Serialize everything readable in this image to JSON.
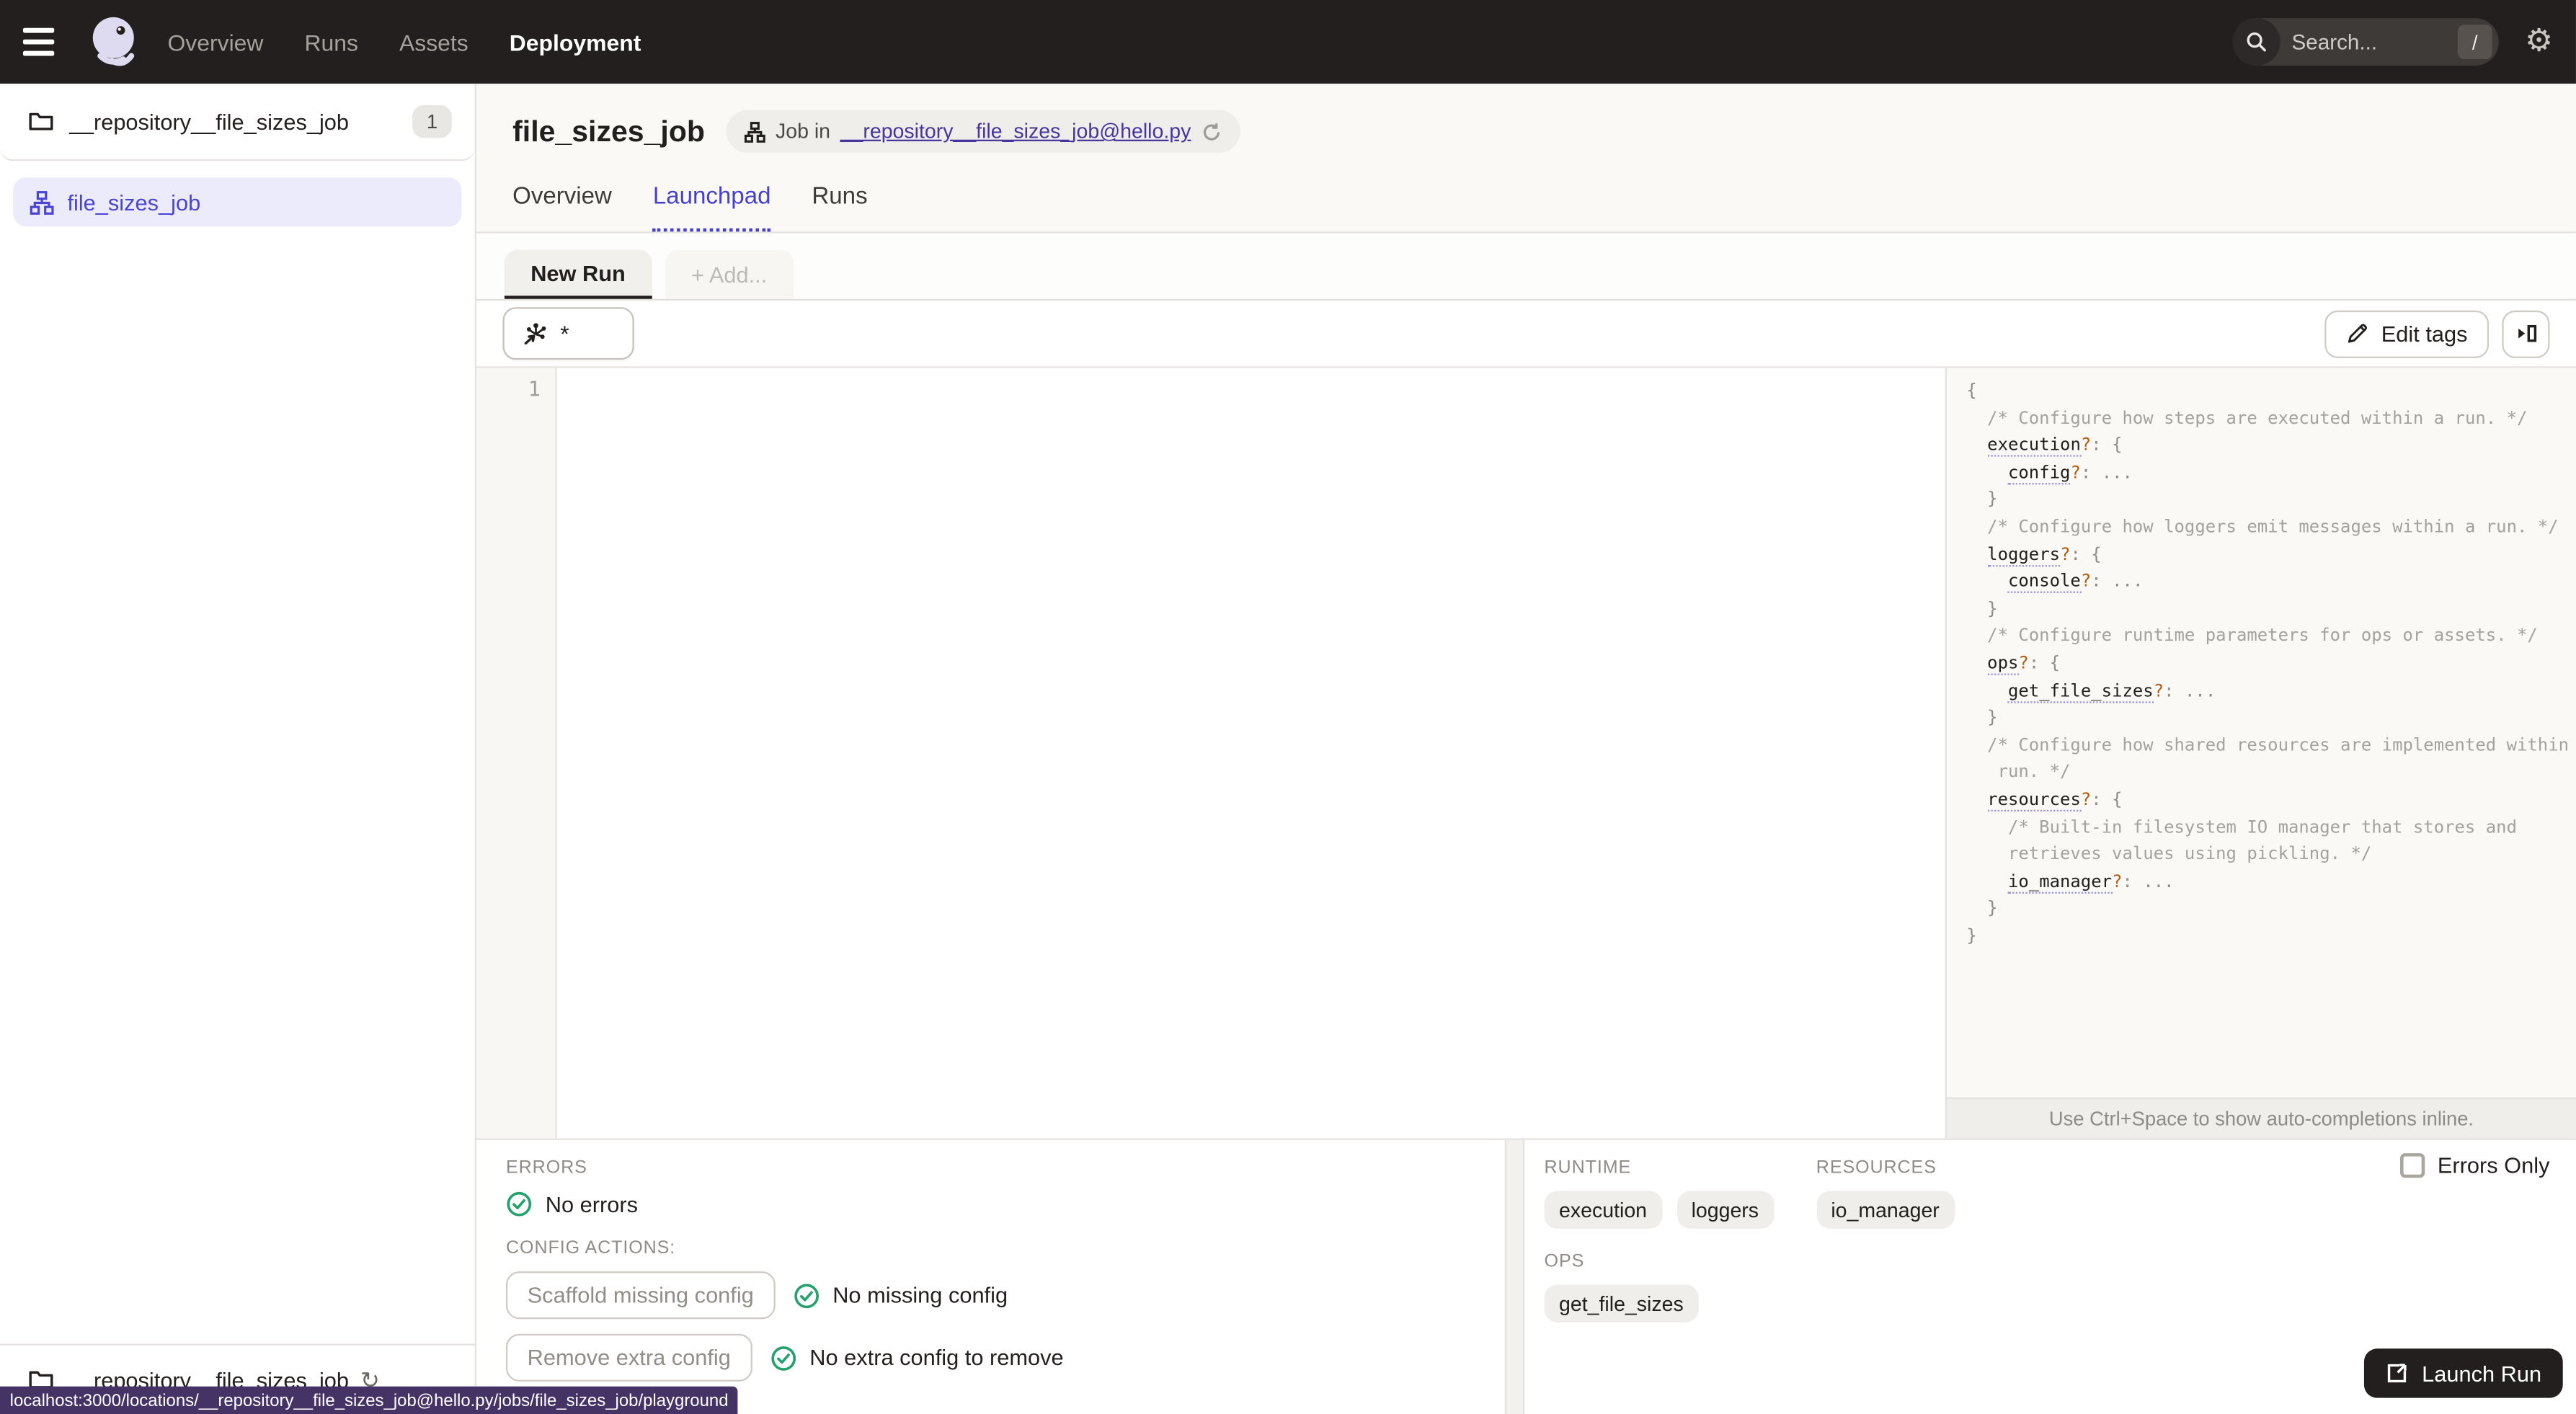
{
  "colors": {
    "nav_bg": "#231f1e",
    "accent": "#4f43dd",
    "accent_dark": "#4640d2",
    "link_purple": "#47359d",
    "success_green": "#23a26d",
    "statusbar_purple": "#463366",
    "selected_item_bg": "#ecebfb",
    "question_orange": "#b35b10"
  },
  "icons": {
    "menu": "hamburger-icon",
    "logo": "dagster-logo",
    "search": "search-icon",
    "shortcut_key": "/",
    "gear": "gear-icon",
    "folder": "folder-icon",
    "job": "job-graph-icon",
    "refresh": "refresh-icon",
    "pencil": "pencil-icon",
    "expand": "expand-panel-icon",
    "op_selector": "op-selector-icon",
    "check": "check-circle-icon",
    "launch": "launch-icon"
  },
  "topnav": {
    "links": [
      {
        "label": "Overview"
      },
      {
        "label": "Runs"
      },
      {
        "label": "Assets"
      },
      {
        "label": "Deployment"
      }
    ],
    "active": "Deployment",
    "search_placeholder": "Search...",
    "search_shortcut": "/"
  },
  "sidebar": {
    "repo": {
      "name": "__repository__file_sizes_job",
      "count": "1"
    },
    "job": {
      "name": "file_sizes_job"
    },
    "footer": {
      "name": "__repository__file_sizes_job"
    }
  },
  "header": {
    "title": "file_sizes_job",
    "job_pill": {
      "prefix": "Job in",
      "link": "__repository__file_sizes_job@hello.py"
    },
    "tabs": [
      {
        "label": "Overview"
      },
      {
        "label": "Launchpad"
      },
      {
        "label": "Runs"
      }
    ],
    "active_tab": "Launchpad"
  },
  "run_tabs": {
    "active": "New Run",
    "add": "+ Add..."
  },
  "toolbar": {
    "op_selector_value": "*",
    "edit_tags_label": "Edit tags"
  },
  "editor": {
    "line_numbers": [
      "1"
    ],
    "content": "",
    "hint": "Use Ctrl+Space to show auto-completions inline."
  },
  "config_schema": {
    "lines": [
      [
        {
          "c": "p",
          "t": "{"
        }
      ],
      [
        {
          "c": "c",
          "t": "  /* Configure how steps are executed within a run. */"
        }
      ],
      [
        {
          "c": "p",
          "t": "  "
        },
        {
          "c": "k",
          "t": "execution"
        },
        {
          "c": "q",
          "t": "?"
        },
        {
          "c": "p",
          "t": ": {"
        }
      ],
      [
        {
          "c": "p",
          "t": "    "
        },
        {
          "c": "k",
          "t": "config"
        },
        {
          "c": "q",
          "t": "?"
        },
        {
          "c": "p",
          "t": ": "
        },
        {
          "c": "e",
          "t": "..."
        }
      ],
      [
        {
          "c": "p",
          "t": "  }"
        }
      ],
      [
        {
          "c": "c",
          "t": "  /* Configure how loggers emit messages within a run. */"
        }
      ],
      [
        {
          "c": "p",
          "t": "  "
        },
        {
          "c": "k",
          "t": "loggers"
        },
        {
          "c": "q",
          "t": "?"
        },
        {
          "c": "p",
          "t": ": {"
        }
      ],
      [
        {
          "c": "p",
          "t": "    "
        },
        {
          "c": "k",
          "t": "console"
        },
        {
          "c": "q",
          "t": "?"
        },
        {
          "c": "p",
          "t": ": "
        },
        {
          "c": "e",
          "t": "..."
        }
      ],
      [
        {
          "c": "p",
          "t": "  }"
        }
      ],
      [
        {
          "c": "c",
          "t": "  /* Configure runtime parameters for ops or assets. */"
        }
      ],
      [
        {
          "c": "p",
          "t": "  "
        },
        {
          "c": "k",
          "t": "ops"
        },
        {
          "c": "q",
          "t": "?"
        },
        {
          "c": "p",
          "t": ": {"
        }
      ],
      [
        {
          "c": "p",
          "t": "    "
        },
        {
          "c": "k",
          "t": "get_file_sizes"
        },
        {
          "c": "q",
          "t": "?"
        },
        {
          "c": "p",
          "t": ": "
        },
        {
          "c": "e",
          "t": "..."
        }
      ],
      [
        {
          "c": "p",
          "t": "  }"
        }
      ],
      [
        {
          "c": "c",
          "t": "  /* Configure how shared resources are implemented within a"
        }
      ],
      [
        {
          "c": "c",
          "t": "   run. */"
        }
      ],
      [
        {
          "c": "p",
          "t": "  "
        },
        {
          "c": "k",
          "t": "resources"
        },
        {
          "c": "q",
          "t": "?"
        },
        {
          "c": "p",
          "t": ": {"
        }
      ],
      [
        {
          "c": "c",
          "t": "    /* Built-in filesystem IO manager that stores and"
        }
      ],
      [
        {
          "c": "c",
          "t": "    retrieves values using pickling. */"
        }
      ],
      [
        {
          "c": "p",
          "t": "    "
        },
        {
          "c": "k",
          "t": "io_manager"
        },
        {
          "c": "q",
          "t": "?"
        },
        {
          "c": "p",
          "t": ": "
        },
        {
          "c": "e",
          "t": "..."
        }
      ],
      [
        {
          "c": "p",
          "t": "  }"
        }
      ],
      [
        {
          "c": "p",
          "t": "}"
        }
      ]
    ]
  },
  "bottom": {
    "errors": {
      "label": "ERRORS",
      "status": "No errors"
    },
    "config_actions": {
      "label": "CONFIG ACTIONS:",
      "actions": [
        {
          "button": "Scaffold missing config",
          "status": "No missing config"
        },
        {
          "button": "Remove extra config",
          "status": "No extra config to remove"
        }
      ]
    },
    "runtime": {
      "label": "RUNTIME",
      "chips": [
        "execution",
        "loggers"
      ]
    },
    "resources": {
      "label": "RESOURCES",
      "chips": [
        "io_manager"
      ]
    },
    "ops": {
      "label": "OPS",
      "chips": [
        "get_file_sizes"
      ]
    },
    "errors_only_label": "Errors Only",
    "errors_only_checked": false,
    "launch_label": "Launch Run"
  },
  "statusbar": {
    "url": "localhost:3000/locations/__repository__file_sizes_job@hello.py/jobs/file_sizes_job/playground"
  }
}
